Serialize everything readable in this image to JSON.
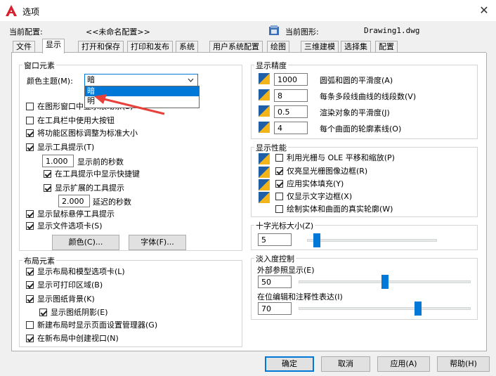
{
  "window": {
    "title": "选项"
  },
  "header": {
    "current_config_label": "当前配置:",
    "current_config_value": "<<未命名配置>>",
    "current_drawing_label": "当前图形:",
    "current_drawing_value": "Drawing1.dwg"
  },
  "tabs": [
    {
      "label": "文件"
    },
    {
      "label": "显示"
    },
    {
      "label": "打开和保存"
    },
    {
      "label": "打印和发布"
    },
    {
      "label": "系统"
    },
    {
      "label": "用户系统配置"
    },
    {
      "label": "绘图"
    },
    {
      "label": "三维建模"
    },
    {
      "label": "选择集"
    },
    {
      "label": "配置"
    }
  ],
  "window_elements": {
    "title": "窗口元素",
    "color_theme_label": "颜色主题(M):",
    "color_theme_value": "暗",
    "color_theme_options": [
      "暗",
      "明"
    ],
    "show_scrollbars": "在图形窗口中显示滚动条(S)",
    "large_buttons": "在工具栏中使用大按钮",
    "resize_ribbon_icons": "将功能区图标调整为标准大小",
    "show_tooltips": "显示工具提示(T)",
    "seconds_before_value": "1.000",
    "seconds_before_label": "显示前的秒数",
    "show_shortcut_keys": "在工具提示中显示快捷键",
    "show_extended_tooltips": "显示扩展的工具提示",
    "delay_value": "2.000",
    "delay_label": "延迟的秒数",
    "show_rollover_tooltips": "显示鼠标悬停工具提示",
    "show_file_tabs": "显示文件选项卡(S)",
    "colors_button": "颜色(C)...",
    "fonts_button": "字体(F)..."
  },
  "layout_elements": {
    "title": "布局元素",
    "show_layout_tabs": "显示布局和模型选项卡(L)",
    "show_printable_area": "显示可打印区域(B)",
    "show_paper_background": "显示图纸背景(K)",
    "show_paper_shadow": "显示图纸阴影(E)",
    "show_page_setup_manager": "新建布局时显示页面设置管理器(G)",
    "create_viewport": "在新布局中创建视口(N)"
  },
  "display_resolution": {
    "title": "显示精度",
    "arc_smoothness_value": "1000",
    "arc_smoothness_label": "圆弧和圆的平滑度(A)",
    "segments_value": "8",
    "segments_label": "每条多段线曲线的线段数(V)",
    "render_smoothness_value": "0.5",
    "render_smoothness_label": "渲染对象的平滑度(J)",
    "contour_lines_value": "4",
    "contour_lines_label": "每个曲面的轮廓素线(O)"
  },
  "display_performance": {
    "title": "显示性能",
    "raster_pan_zoom": "利用光栅与 OLE 平移和缩放(P)",
    "highlight_raster_frame": "仅亮显光栅图像边框(R)",
    "apply_solid_fill": "应用实体填充(Y)",
    "text_boundary_frame": "仅显示文字边框(X)",
    "true_silhouettes": "绘制实体和曲面的真实轮廓(W)"
  },
  "crosshair": {
    "title": "十字光标大小(Z)",
    "value": "5",
    "level_percent": 5
  },
  "fade_control": {
    "title": "淡入度控制",
    "xref_label": "外部参照显示(E)",
    "xref_value": "50",
    "inplace_label": "在位编辑和注释性表达(I)",
    "inplace_value": "70"
  },
  "footer": {
    "ok_button": "确定",
    "cancel_button": "取消",
    "apply_button": "应用(A)",
    "help_button": "帮助(H)"
  },
  "colors": {
    "accent": "#0078d7",
    "app_icon": "#d6202d",
    "perf_icon_blue": "#1f5fa8",
    "perf_icon_yellow": "#f2b418"
  }
}
